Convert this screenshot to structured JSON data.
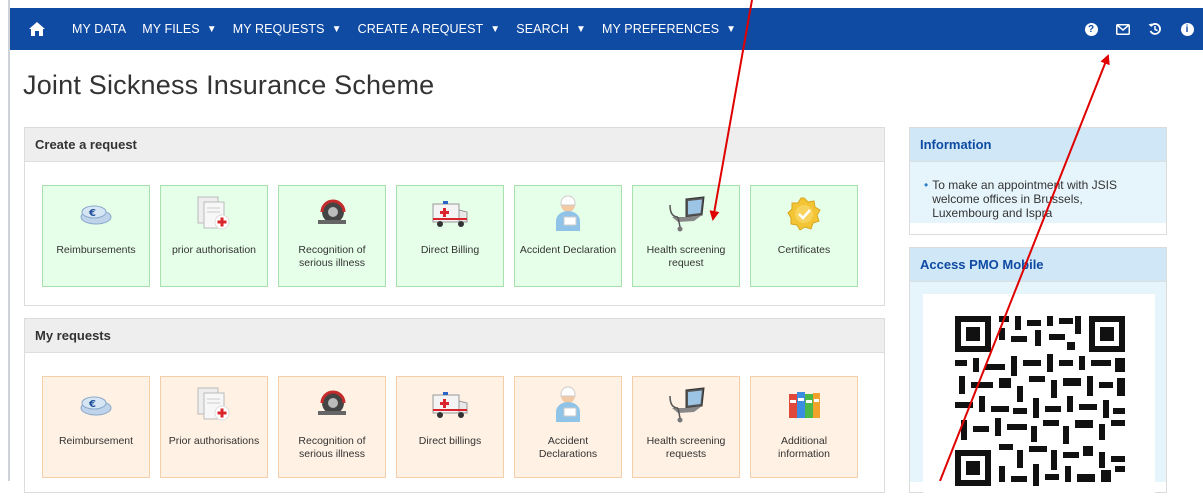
{
  "navbar": {
    "items": [
      {
        "label": "MY DATA",
        "has_caret": false
      },
      {
        "label": "MY FILES",
        "has_caret": true
      },
      {
        "label": "MY REQUESTS",
        "has_caret": true
      },
      {
        "label": "CREATE A REQUEST",
        "has_caret": true
      },
      {
        "label": "SEARCH",
        "has_caret": true
      },
      {
        "label": "MY PREFERENCES",
        "has_caret": true
      }
    ],
    "right_icons": [
      "help-icon",
      "envelope-icon",
      "history-icon",
      "info-icon"
    ],
    "color": "#0f4aa3"
  },
  "page": {
    "title": "Joint Sickness Insurance Scheme"
  },
  "create_request": {
    "title": "Create a request",
    "tiles": [
      {
        "label": "Reimbursements",
        "icon": "euro-coins-icon"
      },
      {
        "label": "prior authorisation",
        "icon": "documents-medical-icon"
      },
      {
        "label": "Recognition of serious illness",
        "icon": "scanner-icon"
      },
      {
        "label": "Direct Billing",
        "icon": "ambulance-icon"
      },
      {
        "label": "Accident Declaration",
        "icon": "injured-person-icon"
      },
      {
        "label": "Health screening request",
        "icon": "laptop-stethoscope-icon"
      },
      {
        "label": "Certificates",
        "icon": "certificate-seal-icon"
      }
    ]
  },
  "my_requests": {
    "title": "My requests",
    "tiles": [
      {
        "label": "Reimbursement",
        "icon": "euro-coins-icon"
      },
      {
        "label": "Prior authorisations",
        "icon": "documents-medical-icon"
      },
      {
        "label": "Recognition of serious illness",
        "icon": "scanner-icon"
      },
      {
        "label": "Direct billings",
        "icon": "ambulance-icon"
      },
      {
        "label": "Accident Declarations",
        "icon": "injured-person-icon"
      },
      {
        "label": "Health screening requests",
        "icon": "laptop-stethoscope-icon"
      },
      {
        "label": "Additional information",
        "icon": "binders-icon"
      }
    ]
  },
  "information": {
    "title": "Information",
    "bullet": "To make an appointment with JSIS welcome offices in Brussels, Luxembourg and Ispra"
  },
  "pmo_mobile": {
    "title": "Access PMO Mobile"
  }
}
